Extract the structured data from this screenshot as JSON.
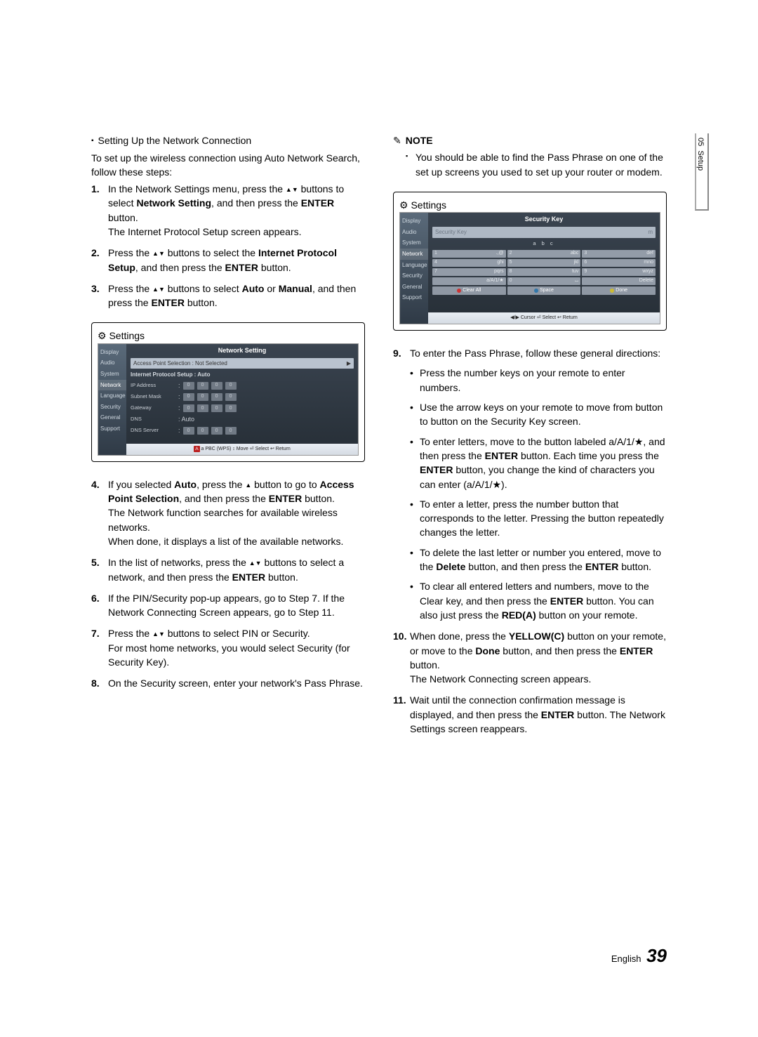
{
  "sideTab": {
    "num": "05",
    "label": "Setup"
  },
  "footer": {
    "lang": "English",
    "page": "39"
  },
  "left": {
    "header": "Setting Up the Network Connection",
    "intro": "To set up the wireless connection using Auto Network Search, follow these steps:",
    "steps": {
      "s1a": "In the Network Settings menu, press the ",
      "s1b": " buttons to select ",
      "s1c": "Network Setting",
      "s1d": ", and then press the ",
      "s1e": "ENTER",
      "s1f": " button.",
      "s1g": "The Internet Protocol Setup screen appears.",
      "s2a": "Press the ",
      "s2b": " buttons to select the ",
      "s2c": "Internet Protocol Setup",
      "s2d": ", and then press the ",
      "s2e": "ENTER",
      "s2f": " button.",
      "s3a": "Press the ",
      "s3b": " buttons to select ",
      "s3c": "Auto",
      "s3d": " or ",
      "s3e": "Manual",
      "s3f": ", and then press the ",
      "s3g": "ENTER",
      "s3h": " button.",
      "s4a": "If you selected ",
      "s4b": "Auto",
      "s4c": ", press the ",
      "s4d": " button to go to ",
      "s4e": "Access Point Selection",
      "s4f": ", and then press the ",
      "s4g": "ENTER",
      "s4h": " button.",
      "s4i": "The Network function searches for available wireless networks.",
      "s4j": "When done, it displays a list of the available networks.",
      "s5a": "In the list of networks, press the ",
      "s5b": " buttons to select a network, and then press the ",
      "s5c": "ENTER",
      "s5d": " button.",
      "s6": "If the PIN/Security pop-up appears, go to Step 7. If the Network Connecting Screen appears, go to Step 11.",
      "s7a": "Press the ",
      "s7b": " buttons to select PIN or Security.",
      "s7c": "For most home networks, you would select Security (for Security Key).",
      "s8": "On the Security screen, enter your network's Pass Phrase."
    }
  },
  "right": {
    "noteTitle": "NOTE",
    "note1": "You should be able to find the Pass Phrase on one of the set up screens you used to set up your router or modem.",
    "s9a": "To enter the Pass Phrase, follow these general directions:",
    "b1": "Press the number keys on your remote to enter numbers.",
    "b2": "Use the arrow keys on your remote to move from button to button on the Security Key screen.",
    "b3a": "To enter letters, move to the button labeled a/A/1/★, and then press the ",
    "b3b": "ENTER",
    "b3c": " button. Each time you press the ",
    "b3d": "ENTER",
    "b3e": " button, you change the kind of characters you can enter (a/A/1/★).",
    "b4": "To enter a letter, press the number button that corresponds to the letter. Pressing the button repeatedly changes the letter.",
    "b5a": "To delete the last letter or number you entered, move to the ",
    "b5b": "Delete",
    "b5c": " button, and then press the ",
    "b5d": "ENTER",
    "b5e": " button.",
    "b6a": "To clear all entered letters and numbers, move to the Clear key, and then press the ",
    "b6b": "ENTER",
    "b6c": " button. You can also just press the ",
    "b6d": "RED(A)",
    "b6e": " button on your remote.",
    "s10a": "When done, press the ",
    "s10b": "YELLOW(C)",
    "s10c": " button on your remote, or move to the ",
    "s10d": "Done",
    "s10e": " button, and then press the ",
    "s10f": "ENTER",
    "s10g": " button.",
    "s10h": "The Network Connecting screen appears.",
    "s11a": "Wait until the connection confirmation message is displayed, and then press the ",
    "s11b": "ENTER",
    "s11c": " button. The Network Settings screen reappears."
  },
  "panel1": {
    "bar": "Settings",
    "sidebar": [
      "Display",
      "Audio",
      "System",
      "Network",
      "Language",
      "Security",
      "General",
      "Support"
    ],
    "title": "Network Setting",
    "aps": "Access Point Selection  :  Not Selected",
    "ips": "Internet Protocol Setup : Auto",
    "rows": {
      "ip": "IP Address",
      "sn": "Subnet Mask",
      "gw": "Gateway",
      "dns": "DNS",
      "dnsv": ": Auto",
      "dnss": "DNS Server"
    },
    "legend": "a PBC (WPS)   ↕ Move   ⏎ Select   ↩ Return",
    "legendA": "A"
  },
  "panel2": {
    "bar": "Settings",
    "sidebar": [
      "Display",
      "Audio",
      "System",
      "Network",
      "Language",
      "Security",
      "General",
      "Support"
    ],
    "title": "Security Key",
    "placeholder": "Security Key",
    "abc": "a  b  c",
    "keys": [
      {
        "n": "1",
        "t": ".,@"
      },
      {
        "n": "2",
        "t": "abc"
      },
      {
        "n": "3",
        "t": "def"
      },
      {
        "n": "4",
        "t": "ghi"
      },
      {
        "n": "5",
        "t": "jkl"
      },
      {
        "n": "6",
        "t": "mno"
      },
      {
        "n": "7",
        "t": "pqrs"
      },
      {
        "n": "8",
        "t": "tuv"
      },
      {
        "n": "9",
        "t": "wxyz"
      },
      {
        "n": "",
        "t": "a/A/1/★"
      },
      {
        "n": "0",
        "t": "⌴"
      },
      {
        "n": "",
        "t": "Delete"
      }
    ],
    "ctrl": {
      "clear": "Clear All",
      "space": "Space",
      "done": "Done"
    },
    "legend": "◀/▶ Cursor   ⏎ Select   ↩ Return"
  }
}
